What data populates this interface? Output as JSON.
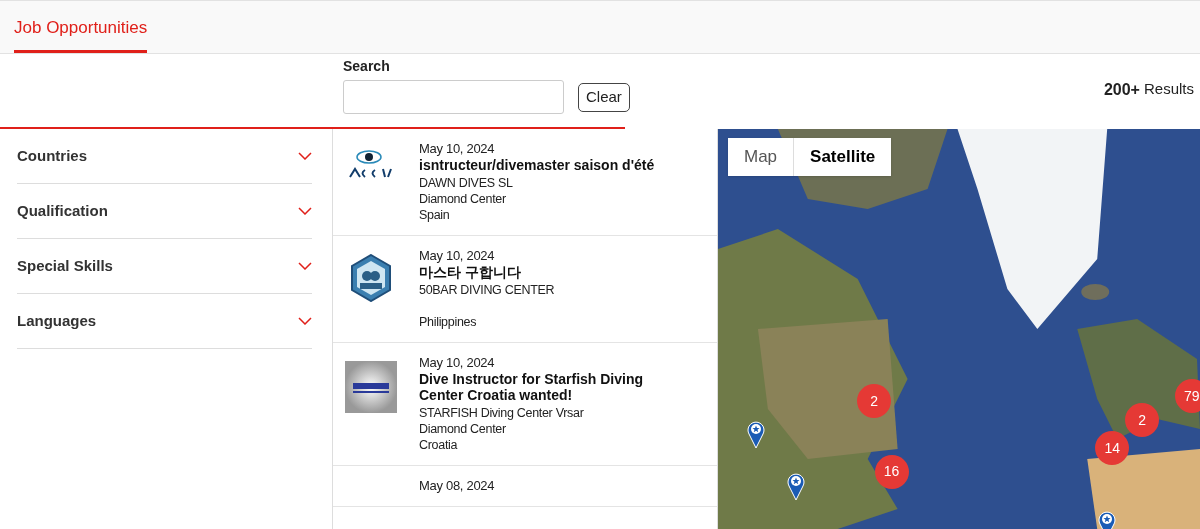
{
  "tabs": [
    {
      "label": "Job Opportunities",
      "selected": true
    }
  ],
  "search": {
    "label": "Search",
    "button": "Clear"
  },
  "results": {
    "count": "200+",
    "label": "Results"
  },
  "filters": [
    {
      "label": "Countries",
      "expanded": false
    },
    {
      "label": "Qualification",
      "expanded": false
    },
    {
      "label": "Special Skills",
      "expanded": false
    },
    {
      "label": "Languages",
      "expanded": false
    }
  ],
  "jobs": [
    {
      "date": "May 10, 2024",
      "title": "isntructeur/divemaster saison d'été",
      "company": "DAWN DIVES SL",
      "center": "Diamond Center",
      "country": "Spain"
    },
    {
      "date": "May 10, 2024",
      "title": "마스타 구합니다",
      "company": "50BAR DIVING CENTER",
      "country": "Philippines"
    },
    {
      "date": "May 10, 2024",
      "title": "Dive Instructor for Starfish Diving Center Croatia wanted!",
      "company": "STARFISH Diving Center Vrsar",
      "center": "Diamond Center",
      "country": "Croatia"
    },
    {
      "date": "May 08, 2024"
    }
  ],
  "map": {
    "types": [
      {
        "label": "Map",
        "selected": false
      },
      {
        "label": "Satellite",
        "selected": true
      }
    ],
    "markers": [
      {
        "kind": "cluster",
        "count": "2"
      },
      {
        "kind": "cluster",
        "count": "16"
      },
      {
        "kind": "cluster",
        "count": "14"
      },
      {
        "kind": "cluster",
        "count": "2"
      },
      {
        "kind": "cluster",
        "count": "79"
      },
      {
        "kind": "pin"
      },
      {
        "kind": "pin"
      },
      {
        "kind": "pin"
      }
    ]
  }
}
